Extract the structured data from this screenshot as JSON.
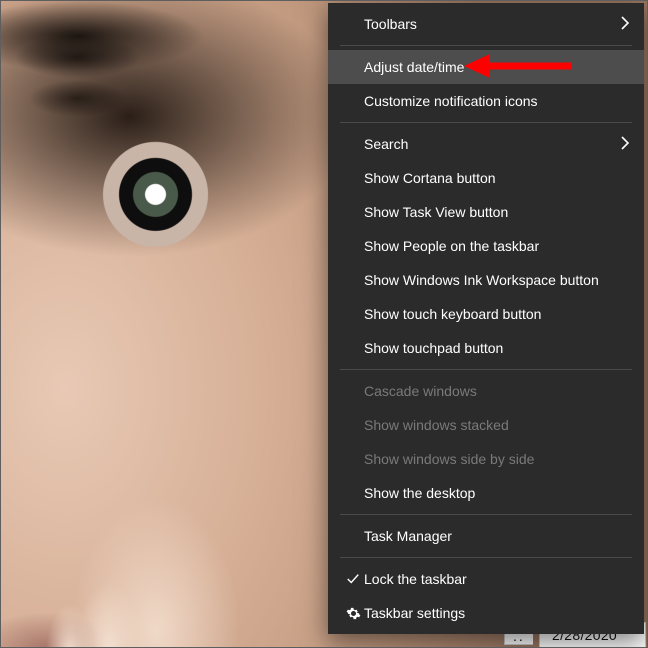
{
  "menu": {
    "groups": [
      [
        {
          "id": "toolbars",
          "label": "Toolbars",
          "submenu": true
        }
      ],
      [
        {
          "id": "adjust-date-time",
          "label": "Adjust date/time",
          "hover": true
        },
        {
          "id": "customize-notification-icons",
          "label": "Customize notification icons"
        }
      ],
      [
        {
          "id": "search",
          "label": "Search",
          "submenu": true
        },
        {
          "id": "show-cortana-button",
          "label": "Show Cortana button"
        },
        {
          "id": "show-task-view-button",
          "label": "Show Task View button"
        },
        {
          "id": "show-people-on-the-taskbar",
          "label": "Show People on the taskbar"
        },
        {
          "id": "show-windows-ink-workspace-button",
          "label": "Show Windows Ink Workspace button"
        },
        {
          "id": "show-touch-keyboard-button",
          "label": "Show touch keyboard button"
        },
        {
          "id": "show-touchpad-button",
          "label": "Show touchpad button"
        }
      ],
      [
        {
          "id": "cascade-windows",
          "label": "Cascade windows",
          "disabled": true
        },
        {
          "id": "show-windows-stacked",
          "label": "Show windows stacked",
          "disabled": true
        },
        {
          "id": "show-windows-side-by-side",
          "label": "Show windows side by side",
          "disabled": true
        },
        {
          "id": "show-the-desktop",
          "label": "Show the desktop"
        }
      ],
      [
        {
          "id": "task-manager",
          "label": "Task Manager"
        }
      ],
      [
        {
          "id": "lock-the-taskbar",
          "label": "Lock the taskbar",
          "icon": "check"
        },
        {
          "id": "taskbar-settings",
          "label": "Taskbar settings",
          "icon": "gear"
        }
      ]
    ]
  },
  "taskbar": {
    "date": "2/28/2020"
  },
  "annotation": {
    "color": "#ff0000"
  }
}
